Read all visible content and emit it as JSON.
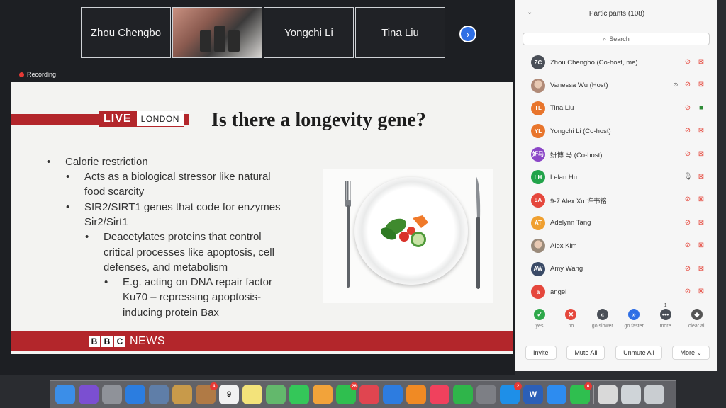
{
  "video_strip": {
    "tiles": [
      {
        "name": "Zhou Chengbo",
        "video": false
      },
      {
        "name": "",
        "video": true
      },
      {
        "name": "Yongchi Li",
        "video": false
      },
      {
        "name": "Tina Liu",
        "video": false
      }
    ],
    "next_icon": "chevron-right-icon"
  },
  "recording": {
    "label": "Recording",
    "color": "#e53935"
  },
  "slide": {
    "live_label": "LIVE",
    "london_label": "LONDON",
    "title": "Is there a longevity gene?",
    "bullets": [
      {
        "level": 0,
        "lines": [
          "Calorie restriction"
        ]
      },
      {
        "level": 1,
        "lines": [
          "Acts as a biological stressor like natural",
          "food scarcity"
        ]
      },
      {
        "level": 1,
        "lines": [
          "SIR2/SIRT1 genes that code for enzymes",
          "Sir2/Sirt1"
        ]
      },
      {
        "level": 2,
        "lines": [
          "Deacetylates proteins that control",
          "critical processes like apoptosis, cell",
          "defenses, and metabolism"
        ]
      },
      {
        "level": 3,
        "lines": [
          "E.g. acting on DNA repair factor",
          "Ku70 – repressing apoptosis-",
          "inducing protein Bax"
        ]
      }
    ],
    "footer_bbc": [
      "B",
      "B",
      "C"
    ],
    "footer_news": "NEWS",
    "accent_color": "#b3262b"
  },
  "participants": {
    "title": "Participants (108)",
    "search_placeholder": "Search",
    "list": [
      {
        "initials": "ZC",
        "name": "Zhou Chengbo (Co-host, me)",
        "color": "#4a4f57",
        "mic": "muted",
        "cam": "off"
      },
      {
        "initials": "",
        "name": "Vanessa Wu (Host)",
        "color": "#b08a77",
        "photo": true,
        "mic": "muted",
        "cam": "off",
        "sharing": true
      },
      {
        "initials": "TL",
        "name": "Tina Liu",
        "color": "#e8752c",
        "mic": "muted",
        "cam": "on"
      },
      {
        "initials": "YL",
        "name": "Yongchi Li (Co-host)",
        "color": "#e8752c",
        "mic": "muted",
        "cam": "off"
      },
      {
        "initials": "妍马",
        "name": "妍博 马 (Co-host)",
        "color": "#8b46c7",
        "mic": "muted",
        "cam": "off"
      },
      {
        "initials": "LH",
        "name": "Lelan Hu",
        "color": "#22a34a",
        "mic": "on",
        "cam": "off"
      },
      {
        "initials": "9A",
        "name": "9-7 Alex Xu 许书铭",
        "color": "#e5473c",
        "mic": "muted",
        "cam": "off"
      },
      {
        "initials": "AT",
        "name": "Adelynn Tang",
        "color": "#f0a030",
        "mic": "muted",
        "cam": "off"
      },
      {
        "initials": "",
        "name": "Alex Kim",
        "color": "#9a8a7a",
        "photo": true,
        "mic": "muted",
        "cam": "off"
      },
      {
        "initials": "AW",
        "name": "Amy Wang",
        "color": "#3a4a66",
        "mic": "muted",
        "cam": "off"
      },
      {
        "initials": "a",
        "name": "angel",
        "color": "#e5473c",
        "mic": "muted",
        "cam": "off"
      }
    ],
    "reactions": [
      {
        "label": "yes",
        "symbol": "✓",
        "color": "#2ea84a",
        "icon": "check-icon"
      },
      {
        "label": "no",
        "symbol": "✕",
        "color": "#e5473c",
        "icon": "cross-icon"
      },
      {
        "label": "go slower",
        "symbol": "«",
        "color": "#4a4f57",
        "icon": "rewind-icon"
      },
      {
        "label": "go faster",
        "symbol": "»",
        "color": "#2f6fe5",
        "icon": "fast-forward-icon"
      },
      {
        "label": "more",
        "symbol": "•••",
        "color": "#4a4f57",
        "icon": "more-icon",
        "count": "1"
      },
      {
        "label": "clear all",
        "symbol": "◆",
        "color": "#555555",
        "icon": "eraser-icon"
      }
    ],
    "actions": [
      "Invite",
      "Mute All",
      "Unmute All",
      "More ⌄"
    ]
  },
  "dock": {
    "apps": [
      {
        "icon": "finder-icon",
        "color": "#3b8ee8"
      },
      {
        "icon": "siri-icon",
        "color": "#7b4fd1"
      },
      {
        "icon": "launchpad-icon",
        "color": "#8f9299"
      },
      {
        "icon": "safari-icon",
        "color": "#2b7de0"
      },
      {
        "icon": "photos-preview-icon",
        "color": "#5f7ea8"
      },
      {
        "icon": "notes-sticky-icon",
        "color": "#c89a4a"
      },
      {
        "icon": "contacts-icon",
        "color": "#b07a45",
        "badge": "4"
      },
      {
        "icon": "calendar-icon",
        "color": "#f2f2f2",
        "text": "9"
      },
      {
        "icon": "stickies-icon",
        "color": "#f3e37a"
      },
      {
        "icon": "maps-icon",
        "color": "#63b86c"
      },
      {
        "icon": "messages-icon",
        "color": "#34c759"
      },
      {
        "icon": "photos-icon",
        "color": "#f2a33a"
      },
      {
        "icon": "facetime-icon",
        "color": "#2fbf4f",
        "badge": "26"
      },
      {
        "icon": "news-icon",
        "color": "#e04550"
      },
      {
        "icon": "keynote-icon",
        "color": "#2d7ce0"
      },
      {
        "icon": "books-icon",
        "color": "#f08a24"
      },
      {
        "icon": "music-icon",
        "color": "#f0415d"
      },
      {
        "icon": "numbers-icon",
        "color": "#2fb54a"
      },
      {
        "icon": "system-preferences-icon",
        "color": "#7d7f85"
      },
      {
        "icon": "app-store-icon",
        "color": "#1e8fe8",
        "badge": "2"
      },
      {
        "icon": "word-icon",
        "color": "#2b5fb8",
        "text": "W"
      },
      {
        "icon": "zoom-icon",
        "color": "#2d8cf0"
      },
      {
        "icon": "wechat-icon",
        "color": "#2fbf4f",
        "badge": "6"
      },
      {
        "icon": "document-icon",
        "color": "#d9d9d9"
      },
      {
        "icon": "screenshot-icon",
        "color": "#cfd4d8"
      },
      {
        "icon": "trash-icon",
        "color": "#c9cdd1"
      }
    ]
  }
}
